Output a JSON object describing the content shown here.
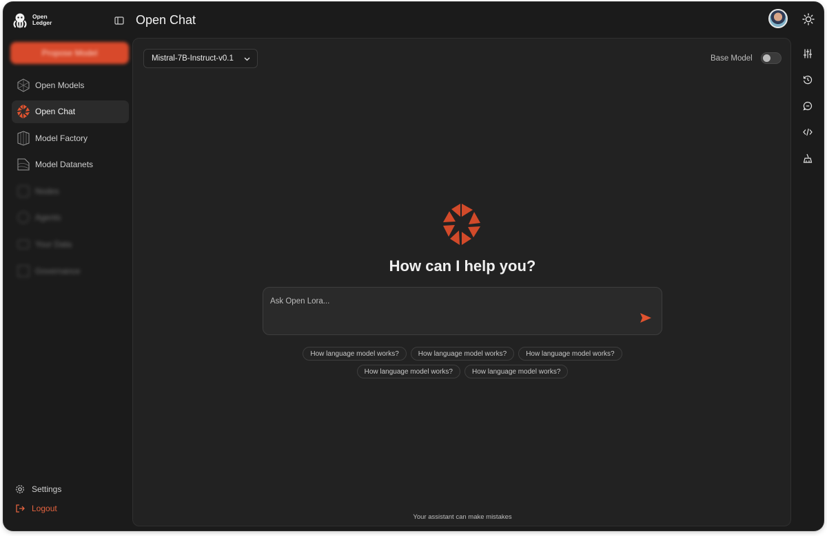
{
  "app": {
    "logo_text_line1": "Open",
    "logo_text_line2": "Ledger",
    "page_title": "Open Chat",
    "accent_color": "#d8492b"
  },
  "sidebar": {
    "primary_button_label": "Propose Model",
    "items": [
      {
        "label": "Open Models",
        "icon": "open-models-icon",
        "active": false
      },
      {
        "label": "Open Chat",
        "icon": "open-chat-icon",
        "active": true
      },
      {
        "label": "Model Factory",
        "icon": "model-factory-icon",
        "active": false
      },
      {
        "label": "Model Datanets",
        "icon": "model-datanets-icon",
        "active": false
      },
      {
        "label": "Nodes",
        "icon": "nodes-icon",
        "active": false
      },
      {
        "label": "Agents",
        "icon": "agents-icon",
        "active": false
      },
      {
        "label": "Your Data",
        "icon": "data-icon",
        "active": false
      },
      {
        "label": "Governance",
        "icon": "governance-icon",
        "active": false
      }
    ],
    "settings_label": "Settings",
    "logout_label": "Logout"
  },
  "main": {
    "model_select_value": "Mistral-7B-Instruct-v0.1",
    "base_model_label": "Base Model",
    "base_model_enabled": false,
    "hero_title": "How can I help you?",
    "input_placeholder": "Ask Open Lora...",
    "suggestions": [
      "How language model works?",
      "How language model works?",
      "How language model works?",
      "How language model works?",
      "How language model works?"
    ],
    "disclaimer": "Your assistant can make mistakes"
  },
  "right_rail": [
    "sliders-icon",
    "history-icon",
    "chat-bubble-icon",
    "code-icon",
    "cleanup-icon"
  ]
}
